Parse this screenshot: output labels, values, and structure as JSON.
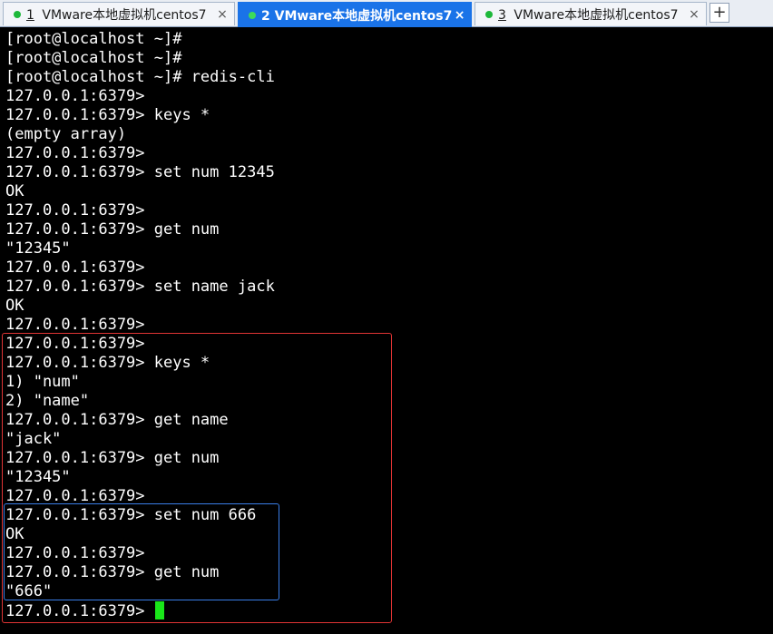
{
  "tabs": [
    {
      "number": "1",
      "title": " VMware本地虚拟机centos7",
      "active": false,
      "close": "×"
    },
    {
      "number": "2",
      "title": " VMware本地虚拟机centos7",
      "active": true,
      "close": "×"
    },
    {
      "number": "3",
      "title": " VMware本地虚拟机centos7",
      "active": false,
      "close": "×"
    }
  ],
  "new_tab_label": "+",
  "terminal": {
    "lines": [
      "[root@localhost ~]#",
      "[root@localhost ~]#",
      "[root@localhost ~]# redis-cli",
      "127.0.0.1:6379>",
      "127.0.0.1:6379> keys *",
      "(empty array)",
      "127.0.0.1:6379>",
      "127.0.0.1:6379> set num 12345",
      "OK",
      "127.0.0.1:6379>",
      "127.0.0.1:6379> get num",
      "\"12345\"",
      "127.0.0.1:6379>",
      "127.0.0.1:6379> set name jack",
      "OK",
      "127.0.0.1:6379>",
      "127.0.0.1:6379>",
      "127.0.0.1:6379> keys *",
      "1) \"num\"",
      "2) \"name\"",
      "127.0.0.1:6379> get name",
      "\"jack\"",
      "127.0.0.1:6379> get num",
      "\"12345\"",
      "127.0.0.1:6379>",
      "127.0.0.1:6379> set num 666",
      "OK",
      "127.0.0.1:6379>",
      "127.0.0.1:6379> get num",
      "\"666\"",
      "127.0.0.1:6379> "
    ],
    "cursor_color": "#19e619"
  },
  "colors": {
    "tab_active_bg": "#1a73e8",
    "status_dot": "#1db83a",
    "highlight_red": "#e03434",
    "highlight_blue": "#3a7ee8"
  }
}
